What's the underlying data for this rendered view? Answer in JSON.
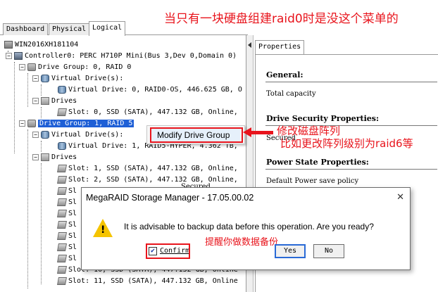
{
  "annotations": {
    "top_note": "当只有一块硬盘组建raid0时是没这个菜单的",
    "modify_note_1": "修改磁盘阵列",
    "modify_note_2": "比如更改阵列级别为raid6等",
    "backup_note": "提醒你做数据备份"
  },
  "tabs": [
    {
      "label": "Dashboard",
      "active": false
    },
    {
      "label": "Physical",
      "active": false
    },
    {
      "label": "Logical",
      "active": true
    }
  ],
  "tree": [
    {
      "label": "WIN2016XH181104",
      "icon": "server-icon"
    },
    {
      "label": "Controller0: PERC H710P Mini(Bus 3,Dev 0,Domain 0)",
      "icon": "controller-icon"
    },
    {
      "label": "Drive Group: 0, RAID  0",
      "icon": "drive-group-icon"
    },
    {
      "label": "Virtual Drive(s):",
      "icon": "virtual-drives-icon"
    },
    {
      "label": "Virtual Drive: 0, RAID0-OS, 446.625 GB, O",
      "icon": "virtual-drive-icon"
    },
    {
      "label": "Drives",
      "icon": "drives-icon"
    },
    {
      "label": "Slot: 0, SSD  (SATA), 447.132 GB, Online,",
      "icon": "disk-icon"
    },
    {
      "label": "Drive Group: 1, RAID  5",
      "icon": "drive-group-icon",
      "selected": true
    },
    {
      "label": "Virtual Drive(s):",
      "icon": "virtual-drives-icon"
    },
    {
      "label": "Virtual Drive: 1, RAID5-HYPER, 4.362 TB,",
      "icon": "virtual-drive-icon"
    },
    {
      "label": "Drives",
      "icon": "drives-icon"
    },
    {
      "label": "Slot: 1, SSD  (SATA), 447.132 GB, Online,",
      "icon": "disk-icon"
    },
    {
      "label": "Slot: 2, SSD  (SATA), 447.132 GB, Online,",
      "icon": "disk-icon"
    },
    {
      "label": "Sl",
      "icon": "disk-icon"
    },
    {
      "label": "Sl",
      "icon": "disk-icon"
    },
    {
      "label": "Sl",
      "icon": "disk-icon"
    },
    {
      "label": "Sl",
      "icon": "disk-icon"
    },
    {
      "label": "Sl",
      "icon": "disk-icon"
    },
    {
      "label": "Sl",
      "icon": "disk-icon"
    },
    {
      "label": "Sl",
      "icon": "disk-icon"
    },
    {
      "label": "Slot: 10, SSD  (SATA), 447.132 GB, Online",
      "icon": "disk-icon"
    },
    {
      "label": "Slot: 11, SSD  (SATA), 447.132 GB, Online",
      "icon": "disk-icon"
    }
  ],
  "properties": {
    "tab_label": "Properties",
    "general": "General:",
    "total_capacity": "Total capacity",
    "security": "Drive Security Properties:",
    "secured": "Secured",
    "power": "Power State Properties:",
    "default_power": "Default Power save policy",
    "secured_behind": "Secured"
  },
  "context_menu": {
    "item": "Modify Drive Group"
  },
  "dialog": {
    "title": "MegaRAID Storage Manager - 17.05.00.02",
    "close": "✕",
    "message": "It is advisable to backup data before this operation. Are you ready?",
    "confirm_label": "Confirm",
    "confirm_checked": true,
    "yes_label": "Yes",
    "no_label": "No",
    "warning_glyph": "!"
  },
  "colors": {
    "annotation_red": "#e8141c",
    "selection_blue": "#1e5fd6",
    "warning_yellow": "#f5c400"
  }
}
